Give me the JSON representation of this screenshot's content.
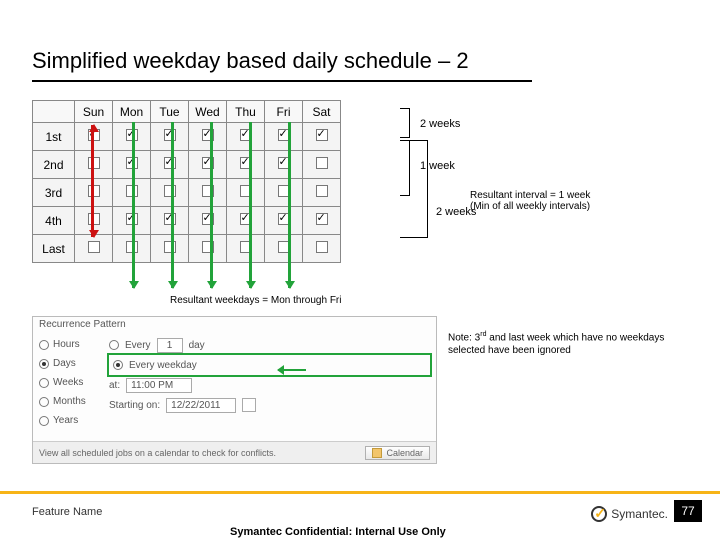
{
  "title": "Simplified weekday based daily schedule – 2",
  "days": [
    "Sun",
    "Mon",
    "Tue",
    "Wed",
    "Thu",
    "Fri",
    "Sat"
  ],
  "rows": [
    "1st",
    "2nd",
    "3rd",
    "4th",
    "Last"
  ],
  "grid": [
    [
      true,
      true,
      true,
      true,
      true,
      true,
      true
    ],
    [
      false,
      true,
      true,
      true,
      true,
      true,
      false
    ],
    [
      false,
      false,
      false,
      false,
      false,
      false,
      false
    ],
    [
      false,
      true,
      true,
      true,
      true,
      true,
      true
    ],
    [
      false,
      false,
      false,
      false,
      false,
      false,
      false
    ]
  ],
  "brackets": {
    "b1": "2 weeks",
    "b2": "1 week",
    "b3": "2 weeks"
  },
  "resultant_interval_label": "Resultant interval = 1 week",
  "resultant_interval_sub": "(Min of all weekly intervals)",
  "resultant_weekdays": "Resultant weekdays = Mon through Fri",
  "note": "Note: 3<sup>rd</sup> and last week which have no weekdays selected have been ignored",
  "recur": {
    "heading": "Recurrence Pattern",
    "units": [
      "Hours",
      "Days",
      "Weeks",
      "Months",
      "Years"
    ],
    "selected_unit_idx": 1,
    "every_label": "Every",
    "every_n": "1",
    "every_unit": "day",
    "every_weekday": "Every weekday",
    "at_label": "at:",
    "at_time": "11:00 PM",
    "start_label": "Starting on:",
    "start_date": "12/22/2011",
    "calendar_hint": "View all scheduled jobs on a calendar to check for conflicts.",
    "calendar_btn": "Calendar"
  },
  "footer": {
    "feature": "Feature Name",
    "confidential": "Symantec Confidential: Internal Use Only",
    "page": "77",
    "brand": "Symantec."
  }
}
